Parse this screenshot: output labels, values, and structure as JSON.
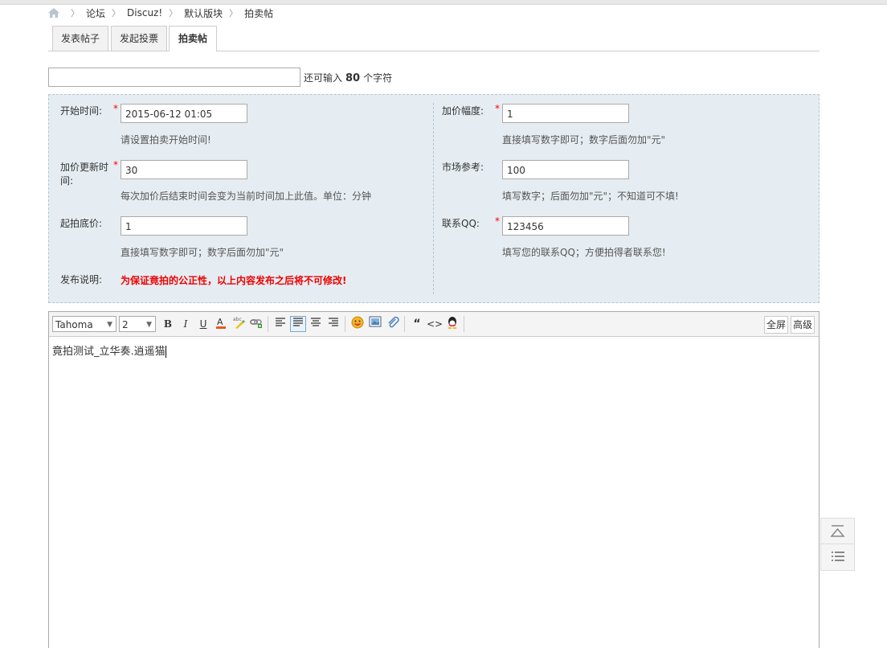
{
  "breadcrumb": {
    "items": [
      "论坛",
      "Discuz!",
      "默认版块",
      "拍卖帖"
    ]
  },
  "tabs": [
    {
      "label": "发表帖子",
      "active": false
    },
    {
      "label": "发起投票",
      "active": false
    },
    {
      "label": "拍卖帖",
      "active": true
    }
  ],
  "subject": {
    "value": "",
    "hint_prefix": "还可输入",
    "remaining": "80",
    "hint_suffix": "个字符"
  },
  "trade": {
    "start_time": {
      "label": "开始时间:",
      "value": "2015-06-12 01:05",
      "tip": "请设置拍卖开始时间!"
    },
    "extend_time": {
      "label": "加价更新时间:",
      "value": "30",
      "tip": "每次加价后结束时间会变为当前时间加上此值。单位：分钟"
    },
    "start_price": {
      "label": "起拍底价:",
      "value": "1",
      "tip": "直接填写数字即可；数字后面勿加\"元\""
    },
    "notice": {
      "label": "发布说明:",
      "text": "为保证竟拍的公正性，以上内容发布之后将不可修改!"
    },
    "increment": {
      "label": "加价幅度:",
      "value": "1",
      "tip": "直接填写数字即可；数字后面勿加\"元\""
    },
    "market_ref": {
      "label": "市场参考:",
      "value": "100",
      "tip": "填写数字；后面勿加\"元\"；不知道可不填!"
    },
    "contact_qq": {
      "label": "联系QQ:",
      "value": "123456",
      "tip": "填写您的联系QQ；方便拍得者联系您!"
    },
    "required_mark": "*"
  },
  "editor": {
    "font_family": "Tahoma",
    "font_size": "2",
    "fullscreen_label": "全屏",
    "advanced_label": "高级",
    "content": "竟拍测试_立华奏.逍遥猫"
  },
  "colors": {
    "trade_bg": "#e5edf2",
    "warning": "#e00000",
    "required": "#ff0000"
  },
  "icons": [
    "home-icon",
    "bold-icon",
    "italic-icon",
    "underline-icon",
    "font-color-icon",
    "highlight-icon",
    "link-icon",
    "align-left-icon",
    "align-justify-icon",
    "align-center-icon",
    "align-right-icon",
    "smiley-icon",
    "image-icon",
    "attachment-icon",
    "quote-icon",
    "code-icon",
    "qq-icon",
    "back-to-top-icon",
    "list-icon"
  ]
}
